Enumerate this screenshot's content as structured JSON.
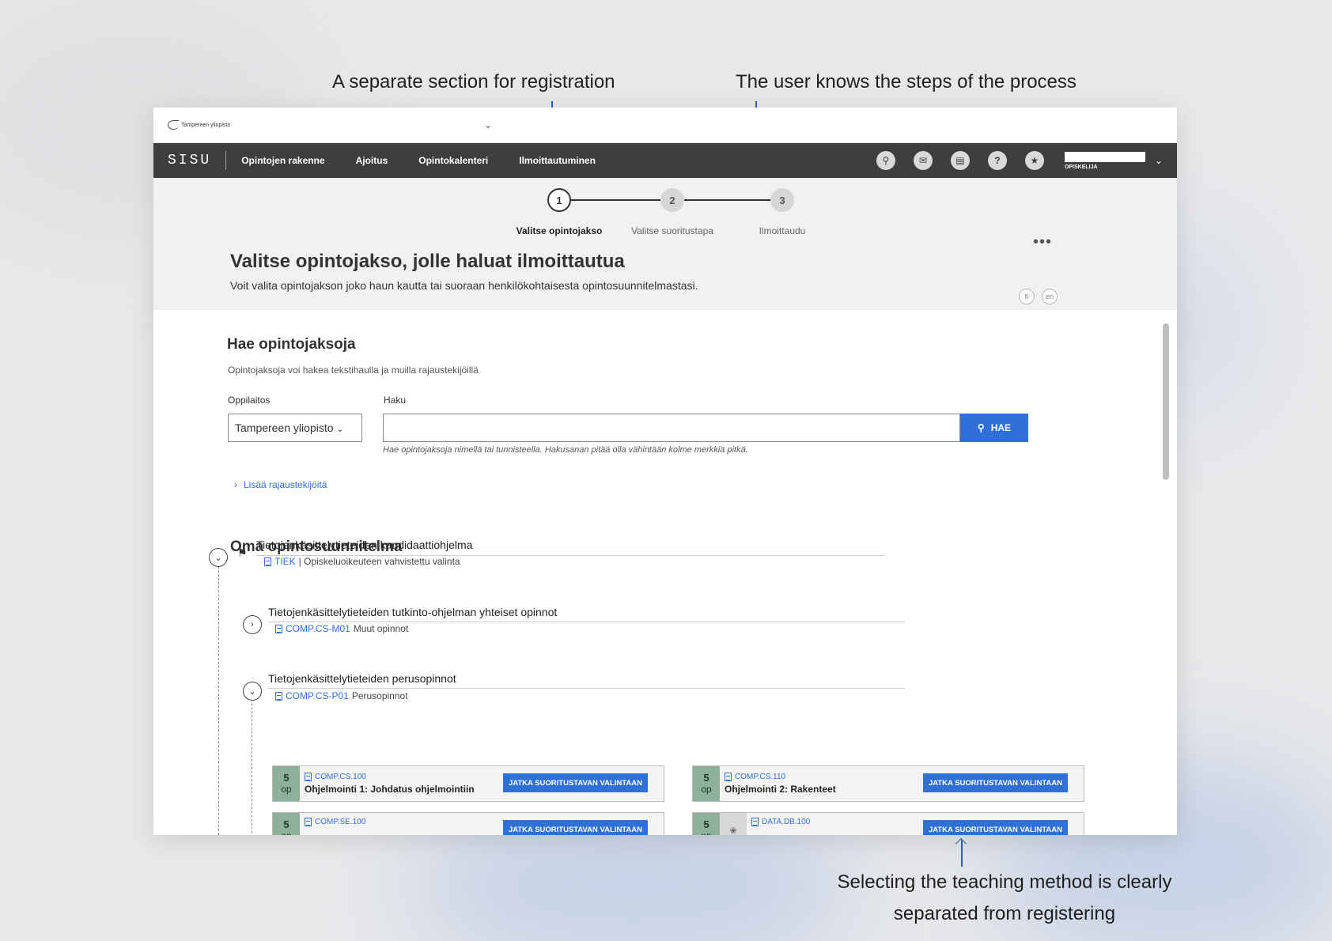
{
  "annotations": {
    "registration": "A separate section for registration",
    "steps": "The user knows the steps of the process",
    "teaching_method_line1": "Selecting the teaching method is clearly",
    "teaching_method_line2": "separated from registering"
  },
  "topbar": {
    "university": "Tampereen yliopisto"
  },
  "navbar": {
    "brand": "SISU",
    "items": [
      "Opintojen rakenne",
      "Ajoitus",
      "Opintokalenteri",
      "Ilmoittautuminen"
    ],
    "user_role": "OPISKELIJA"
  },
  "stepper": {
    "steps": [
      {
        "number": "1",
        "label": "Valitse opintojakso"
      },
      {
        "number": "2",
        "label": "Valitse suoritustapa"
      },
      {
        "number": "3",
        "label": "Ilmoittaudu"
      }
    ],
    "active_step": 1
  },
  "header": {
    "title": "Valitse opintojakso, jolle haluat ilmoittautua",
    "subtitle": "Voit valita opintojakson joko haun kautta tai suoraan henkilökohtaisesta opintosuunnitelmastasi.",
    "languages": [
      "fi",
      "en"
    ]
  },
  "search": {
    "title": "Hae opintojaksoja",
    "subtitle": "Opintojaksoja voi hakea tekstihaulla ja muilla rajaustekijöillä",
    "institution_label": "Oppilaitos",
    "institution_value": "Tampereen yliopisto",
    "query_label": "Haku",
    "query_value": "",
    "button": "HAE",
    "hint": "Hae opintojaksoja nimellä tai tunnisteella. Hakusanan pitää olla vähintään kolme merkkiä pitkä.",
    "more_filters": "Lisää rajaustekijöitä"
  },
  "plan": {
    "title": "Oma opintosuunnitelma",
    "nodes": [
      {
        "title": "Tietojenkäsittelytieteiden kandidaattiohjelma",
        "code": "TIEK",
        "desc": "| Opiskeluoikeuteen vahvistettu valinta",
        "expanded": true
      },
      {
        "title": "Tietojenkäsittelytieteiden tutkinto-ohjelman yhteiset opinnot",
        "code": "COMP.CS-M01",
        "desc": "Muut opinnot",
        "expanded": false
      },
      {
        "title": "Tietojenkäsittelytieteiden perusopinnot",
        "code": "COMP.CS-P01",
        "desc": "Perusopinnot",
        "expanded": true
      }
    ],
    "courses": [
      {
        "credits": "5",
        "unit": "op",
        "code": "COMP.CS.100",
        "name": "Ohjelmointi 1: Johdatus ohjelmointiin",
        "button": "JATKA SUORITUSTAVAN VALINTAAN"
      },
      {
        "credits": "5",
        "unit": "op",
        "code": "COMP.CS.110",
        "name": "Ohjelmointi 2: Rakenteet",
        "button": "JATKA SUORITUSTAVAN VALINTAAN"
      },
      {
        "credits": "5",
        "unit": "op",
        "code": "COMP.SE.100",
        "name": "",
        "button": "JATKA SUORITUSTAVAN VALINTAAN"
      },
      {
        "credits": "5",
        "unit": "op",
        "code": "DATA.DB.100",
        "name": "",
        "button": "JATKA SUORITUSTAVAN VALINTAAN"
      }
    ]
  },
  "colors": {
    "navbar": "#3e3e3e",
    "primary": "#2f6fd6",
    "credits": "#8fb19a",
    "annotation_arrow": "#2f5fae"
  }
}
